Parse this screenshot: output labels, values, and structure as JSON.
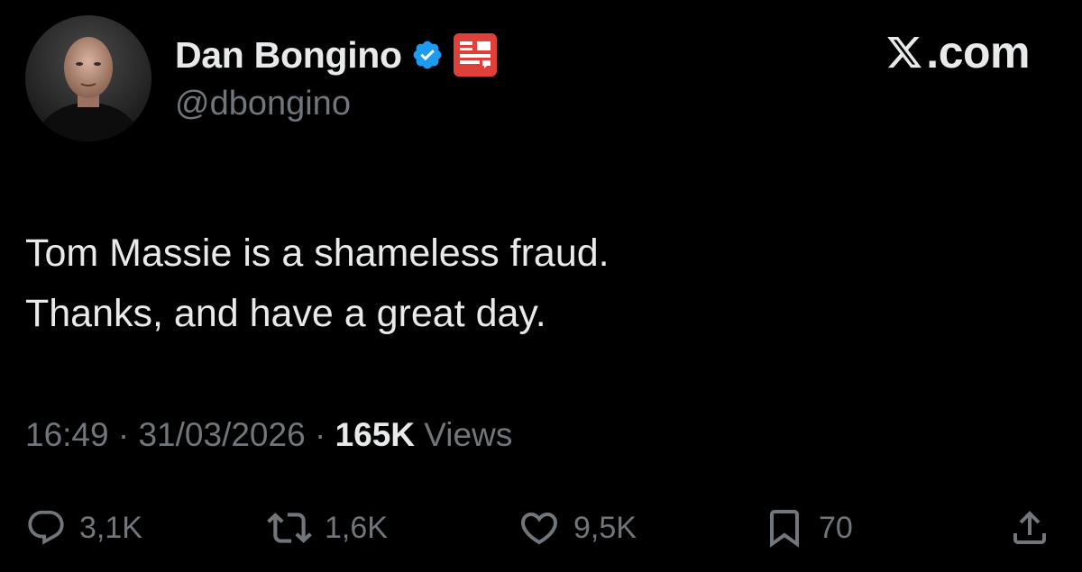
{
  "author": {
    "display_name": "Dan Bongino",
    "handle": "@dbongino",
    "verified": true
  },
  "brand": {
    "text": ".com",
    "icon": "x-logo-icon"
  },
  "tweet": {
    "lines": [
      "Tom Massie is a shameless fraud.",
      "Thanks, and have a great day."
    ]
  },
  "meta": {
    "time": "16:49",
    "date": "31/03/2026",
    "separator": "·",
    "views_count": "165K",
    "views_label": "Views"
  },
  "actions": {
    "replies": "3,1K",
    "reposts": "1,6K",
    "likes": "9,5K",
    "bookmarks": "70"
  },
  "colors": {
    "background": "#000000",
    "primary_text": "#e7e9ea",
    "secondary_text": "#71767b",
    "verified_blue": "#1d9bf0",
    "affiliate_red": "#e0403a"
  }
}
